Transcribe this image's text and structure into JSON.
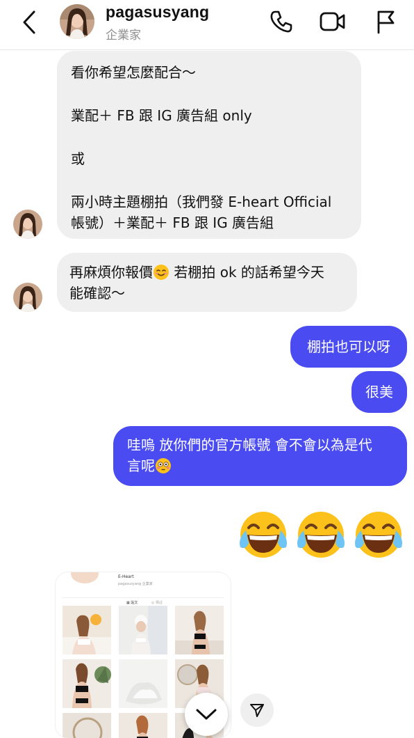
{
  "header": {
    "username": "pagasusyang",
    "subtitle": "企業家"
  },
  "messages": {
    "m1": {
      "line1": "看你希望怎麼配合～",
      "line2": "業配＋ FB 跟 IG 廣告組 only",
      "line3": "或",
      "line4": "兩小時主題棚拍（我們發 E-heart Official",
      "line5": "帳號）＋業配＋ FB 跟 IG 廣告組"
    },
    "m2": {
      "line1a": "再麻煩你報價",
      "line1b": " 若棚拍 ok 的話希望今天",
      "line2": "能確認～"
    },
    "m3": "棚拍也可以呀",
    "m4": "很美",
    "m5": {
      "line1": "哇嗚 放你們的官方帳號 會不會以為是代",
      "line2": "言呢"
    }
  },
  "shared_post": {
    "name": "E-Heart",
    "handle": "pagasusyang 企業家",
    "tab1": "▦ 貼文",
    "tab2": "◎ 標註"
  },
  "icons": {
    "back": "chevron-left-icon",
    "call": "phone-icon",
    "video": "video-camera-icon",
    "report": "flag-icon",
    "scroll_down": "chevron-down-icon",
    "share": "paper-plane-icon"
  },
  "colors": {
    "outgoing_bubble": "#4a4bf0",
    "incoming_bubble": "#efefef",
    "subtitle_gray": "#8e8e8e"
  }
}
